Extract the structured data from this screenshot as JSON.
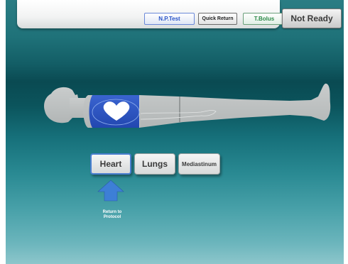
{
  "top_bar": {
    "np_test_label": "N.P.Test",
    "quick_return_label": "Quick Return",
    "t_bolus_label": "T.Bolus"
  },
  "status": {
    "not_ready_label": "Not Ready"
  },
  "body_diagram": {
    "selected_region": "heart",
    "highlight_color": "#2e56c4",
    "icons": [
      "heart-icon"
    ]
  },
  "protocol_buttons": {
    "heart_label": "Heart",
    "lungs_label": "Lungs",
    "mediastinum_label": "Mediastinum"
  },
  "return": {
    "label": "Return to\nProtocol",
    "arrow_color": "#3d7fd6"
  }
}
